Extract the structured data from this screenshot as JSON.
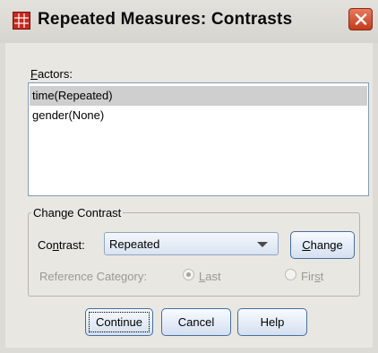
{
  "window": {
    "title": "Repeated Measures: Contrasts",
    "icon": "spss-grid-icon",
    "close_icon": "close-icon"
  },
  "factors": {
    "label_accel": "F",
    "label_rest": "actors:",
    "items": [
      {
        "label": "time(Repeated)",
        "selected": true
      },
      {
        "label": "gender(None)",
        "selected": false
      }
    ]
  },
  "change_contrast": {
    "group_title": "Change Contrast",
    "contrast_label_pre": "Co",
    "contrast_label_accel": "n",
    "contrast_label_post": "trast:",
    "contrast_value": "Repeated",
    "change_button_accel": "C",
    "change_button_rest": "hange",
    "reference_label": "Reference Category:",
    "last_accel": "L",
    "last_rest": "ast",
    "first_pre": "Fir",
    "first_accel": "s",
    "first_post": "t",
    "selected_reference": "Last"
  },
  "buttons": {
    "continue": "Continue",
    "cancel": "Cancel",
    "help": "Help"
  },
  "colors": {
    "title_bar": "#d6d5cf",
    "close_button": "#c43a1c",
    "dialog_bg": "#e8e7e2",
    "selection": "#cfcfcf"
  }
}
